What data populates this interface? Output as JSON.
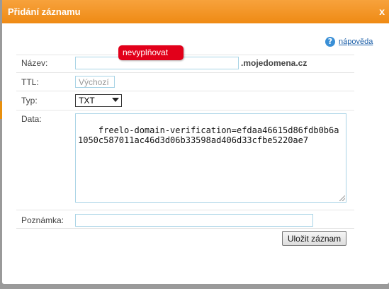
{
  "dialog": {
    "title": "Přidání záznamu",
    "close_label": "x"
  },
  "help": {
    "icon_glyph": "?",
    "label": "nápověda"
  },
  "form": {
    "name": {
      "label": "Název:",
      "value": "",
      "suffix": ".mojedomena.cz"
    },
    "tooltip": "nevyplňovat",
    "ttl": {
      "label": "TTL:",
      "placeholder": "Výchozí"
    },
    "type": {
      "label": "Typ:",
      "selected": "TXT"
    },
    "data": {
      "label": "Data:",
      "value": "freelo-domain-verification=efdaa46615d86fdb0b6a1050c587011ac46d3d06b33598ad406d33cfbe5220ae7"
    },
    "note": {
      "label": "Poznámka:",
      "value": ""
    },
    "save_label": "Uložit záznam"
  },
  "colors": {
    "titlebar": "#ef8a14",
    "tooltip": "#e2001a",
    "input_border": "#a9d4e6",
    "link": "#1c5fa8"
  }
}
